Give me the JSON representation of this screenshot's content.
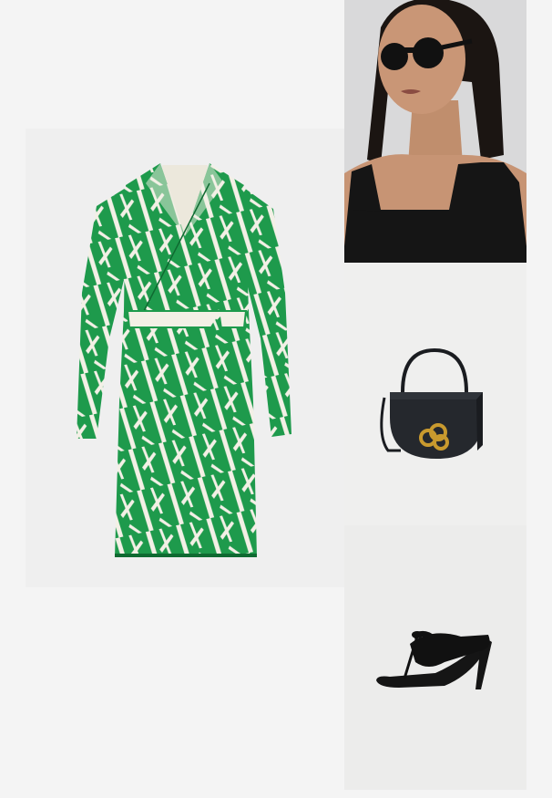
{
  "collage": {
    "products": [
      {
        "id": "dress",
        "kind": "green and white print wrap dress"
      },
      {
        "id": "sunglasses",
        "kind": "model wearing black round sunglasses and black square-neck top"
      },
      {
        "id": "bag",
        "kind": "black leather half-moon handbag with gold knot clasp"
      },
      {
        "id": "sandals",
        "kind": "black leather thong heeled mule sandal"
      }
    ]
  },
  "colors": {
    "page_bg": "#f4f4f4",
    "dress_green": "#1e9a4c",
    "dress_cream": "#f3f0e6",
    "black": "#141414",
    "gold": "#c99a2e"
  }
}
